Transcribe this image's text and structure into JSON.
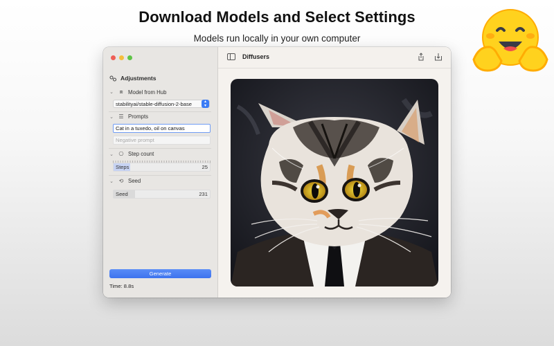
{
  "promo": {
    "headline": "Download Models and Select Settings",
    "subhead": "Models run locally in your own computer"
  },
  "window": {
    "toolbar": {
      "title": "Diffusers"
    },
    "sidebar": {
      "section_title": "Adjustments",
      "model_section": {
        "label": "Model from Hub",
        "selected": "stabilityai/stable-diffusion-2-base"
      },
      "prompts_section": {
        "label": "Prompts",
        "prompt_value": "Cat in a tuxedo, oil on canvas",
        "negative_placeholder": "Negative prompt"
      },
      "steps_section": {
        "label": "Step count",
        "slider_label": "Steps",
        "value": "25",
        "fill_fraction": 0.17
      },
      "seed_section": {
        "label": "Seed",
        "slider_label": "Seed",
        "value": "231",
        "fill_fraction": 0.22
      },
      "generate_label": "Generate",
      "time_text": "Time: 8.8s"
    }
  },
  "icons": [
    "sidebar-toggle-icon",
    "share-icon",
    "save-icon",
    "adjustments-icon",
    "cube-icon",
    "list-icon",
    "steps-icon",
    "seed-icon",
    "chevron-down-icon",
    "hugging-face-emoji"
  ]
}
